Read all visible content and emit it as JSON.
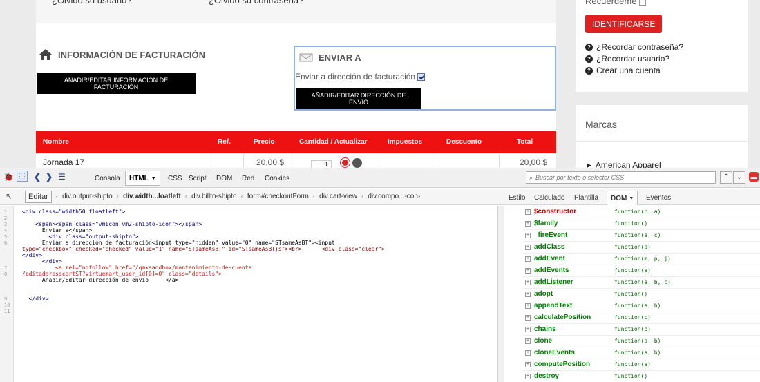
{
  "page": {
    "login_links": {
      "forgot_user": "¿Olvidó su usuario?",
      "forgot_pass": "¿Olvidó su contraseña?"
    },
    "billing": {
      "title": "INFORMACIÓN DE FACTURACIÓN",
      "button": "AÑADIR/EDITAR INFORMACIÓN DE FACTURACIÓN"
    },
    "shipto": {
      "title": "ENVIAR A",
      "checkbox_label": "Enviar a dirección de facturación",
      "button": "AÑADIR/EDITAR DIRECCIÓN DE ENVÍO"
    },
    "cart": {
      "headers": [
        "Nombre",
        "Ref.",
        "Precio",
        "Cantidad / Actualizar",
        "Impuestos",
        "Descuento",
        "Total"
      ],
      "row": {
        "name": "Jornada 17",
        "price": "20,00 $",
        "qty": "1",
        "total": "20,00 $"
      }
    },
    "sidebar": {
      "remember": "Recuérdeme",
      "login_button": "IDENTIFICARSE",
      "links": [
        "¿Recordar contraseña?",
        "¿Recordar usuario?",
        "Crear una cuenta"
      ],
      "brands_title": "Marcas",
      "brand_item": "American Apparel"
    }
  },
  "firebug": {
    "tabs": [
      "Consola",
      "HTML",
      "CSS",
      "Script",
      "DOM",
      "Red",
      "Cookies"
    ],
    "search_placeholder": "Buscar por texto o selector CSS",
    "edit_label": "Editar",
    "breadcrumbs": [
      "div.output-shipto",
      "div.width...loatleft",
      "div.billto-shipto",
      "form#checkoutForm",
      "div.cart-view",
      "div.compo...-con›"
    ],
    "side_tabs": [
      "Estilo",
      "Calculado",
      "Plantilla",
      "DOM",
      "Eventos"
    ],
    "code_lines": [
      "<div class=\"width50 floatleft\">",
      "",
      "    <span><span class=\"vmicon vm2-shipto-icon\"></span>",
      "      Enviar a</span>",
      "        <div class=\"output-shipto\">",
      "      Enviar a dirección de facturación<input type=\"hidden\" value=\"0\" name=\"STsameAsBT\"><input",
      "type=\"checkbox\" checked=\"checked\" value=\"1\" name=\"STsameAsBT\" id=\"STsameAsBTjs\"><br>      <div class=\"clear\">",
      "</div>",
      "      </div>",
      "          <a rel=\"nofollow\" href=\"/qmxsandbox/mantenimiento-de-cuenta",
      "/editaddresscartST?virtuemart_user_id[0]=0\" class=\"details\">",
      "      Añadir/Editar dirección de envío     </a>",
      "",
      "  </div>"
    ],
    "line_numbers": [
      "1",
      "2",
      "3",
      "4",
      "5",
      "6",
      "7",
      "8",
      "9",
      "10",
      "11"
    ],
    "dom_members": [
      {
        "name": "$constructor",
        "value": "function(b, a)"
      },
      {
        "name": "$family",
        "value": "function()"
      },
      {
        "name": "_fireEvent",
        "value": "function(a, c)"
      },
      {
        "name": "addClass",
        "value": "function(a)"
      },
      {
        "name": "addEvent",
        "value": "function(m, p, j)"
      },
      {
        "name": "addEvents",
        "value": "function(a)"
      },
      {
        "name": "addListener",
        "value": "function(a, b, c)"
      },
      {
        "name": "adopt",
        "value": "function()"
      },
      {
        "name": "appendText",
        "value": "function(a, b)"
      },
      {
        "name": "calculatePosition",
        "value": "function(c)"
      },
      {
        "name": "chains",
        "value": "function(b)"
      },
      {
        "name": "clone",
        "value": "function(a, b)"
      },
      {
        "name": "cloneEvents",
        "value": "function(a, b)"
      },
      {
        "name": "computePosition",
        "value": "function(a)"
      },
      {
        "name": "destroy",
        "value": "function()"
      }
    ]
  }
}
